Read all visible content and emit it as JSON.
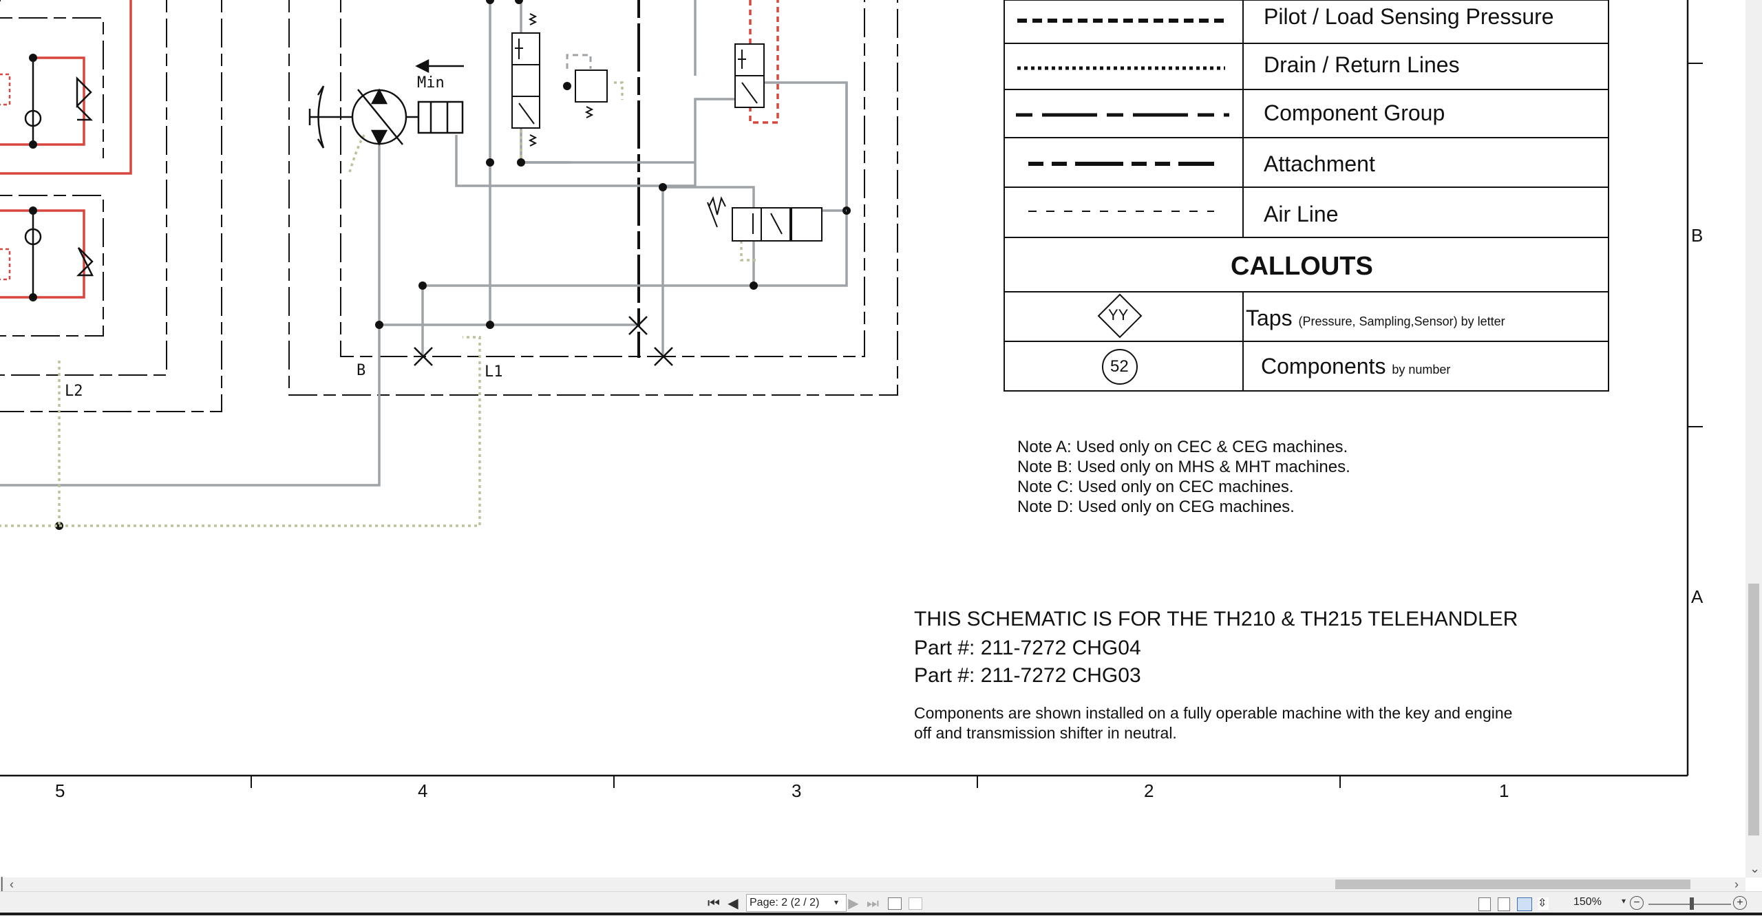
{
  "legend": {
    "rows": [
      {
        "label": "Pilot / Load Sensing Pressure"
      },
      {
        "label": "Drain / Return Lines"
      },
      {
        "label": "Component Group"
      },
      {
        "label": "Attachment"
      },
      {
        "label": "Air Line"
      }
    ],
    "callouts_header": "CALLOUTS",
    "taps": {
      "symbol": "YY",
      "label": "Taps",
      "sublabel": "(Pressure, Sampling,Sensor) by letter"
    },
    "components": {
      "symbol": "52",
      "label": "Components",
      "sublabel": "by number"
    }
  },
  "notes": [
    "Note A: Used only on CEC & CEG machines.",
    "Note B: Used only on MHS & MHT machines.",
    "Note C: Used only on CEC machines.",
    "Note D: Used only on CEG machines."
  ],
  "title_block": {
    "title": "THIS SCHEMATIC IS FOR THE TH210 & TH215 TELEHANDLER",
    "part1": "Part #: 211-7272 CHG04",
    "part2": "Part #: 211-7272 CHG03",
    "desc1": "Components are shown installed on a fully operable machine with the key and engine",
    "desc2": "off and transmission shifter in neutral."
  },
  "schematic_labels": {
    "min": "Min",
    "b": "B",
    "l1": "L1",
    "l2": "L2"
  },
  "grid": {
    "columns": [
      "5",
      "4",
      "3",
      "2",
      "1"
    ],
    "rows": [
      "B",
      "A"
    ]
  },
  "statusbar": {
    "page_value": "Page: 2 (2 / 2)",
    "zoom": "150%"
  },
  "colors": {
    "hydraulic_red": "#d9463f",
    "line_gray": "#9ea3a8",
    "drain_green": "#b9c39a",
    "pilot_red": "#d9463f"
  }
}
